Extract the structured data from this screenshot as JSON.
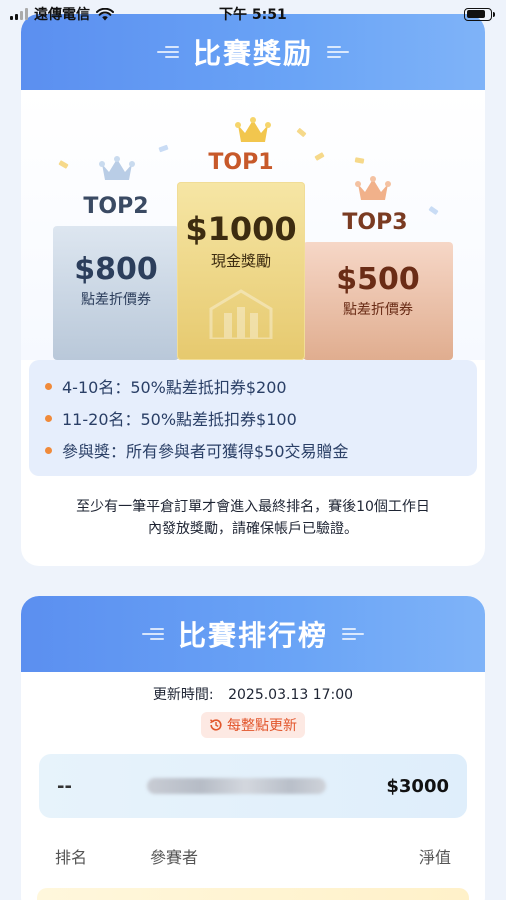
{
  "status_bar": {
    "carrier": "遠傳電信",
    "time": "下午 5:51"
  },
  "reward": {
    "title": "比賽獎励",
    "podium": [
      {
        "rank": "TOP2",
        "amount": "$800",
        "desc": "點差折價券"
      },
      {
        "rank": "TOP1",
        "amount": "$1000",
        "desc": "現金獎勵"
      },
      {
        "rank": "TOP3",
        "amount": "$500",
        "desc": "點差折價券"
      }
    ],
    "tiers": [
      "4-10名：50%點差抵扣券$200",
      "11-20名：50%點差抵扣券$100",
      "參與獎：所有參與者可獲得$50交易贈金"
    ],
    "note_line1": "至少有一筆平倉訂單才會進入最終排名，賽後10個工作日",
    "note_line2": "內發放獎勵，請確保帳戶已驗證。"
  },
  "leaderboard": {
    "title": "比賽排行榜",
    "update_label": "更新時間:",
    "update_time": "2025.03.13 17:00",
    "refresh_badge": "每整點更新",
    "my_entry": {
      "rank": "--",
      "value": "$3000"
    },
    "columns": [
      "排名",
      "參賽者",
      "淨值"
    ]
  },
  "colors": {
    "header_blue": "#5b8ff0",
    "accent_orange": "#f08a3a",
    "badge_red": "#e2562c"
  }
}
